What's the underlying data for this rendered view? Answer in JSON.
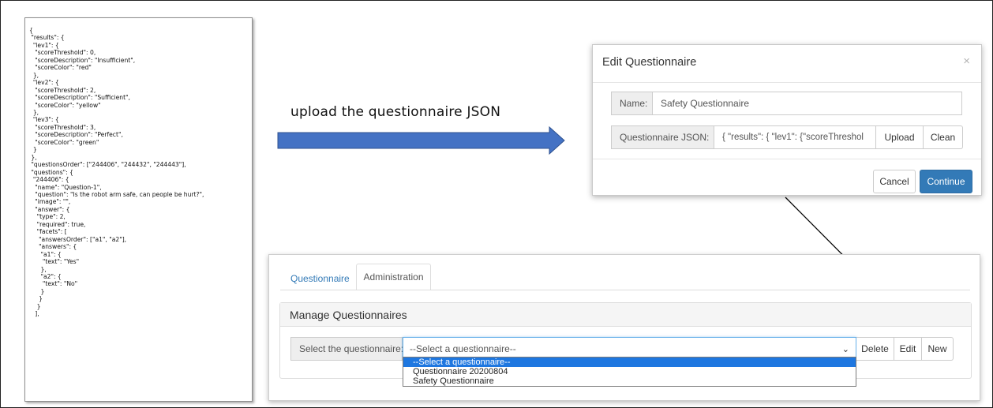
{
  "json_document": {
    "lines": [
      "{",
      " \"results\": {",
      "  \"lev1\": {",
      "   \"scoreThreshold\": 0,",
      "   \"scoreDescription\": \"Insufficient\",",
      "   \"scoreColor\": \"red\"",
      "  },",
      "  \"lev2\": {",
      "   \"scoreThreshold\": 2,",
      "   \"scoreDescription\": \"Sufficient\",",
      "   \"scoreColor\": \"yellow\"",
      "  },",
      "  \"lev3\": {",
      "   \"scoreThreshold\": 3,",
      "   \"scoreDescription\": \"Perfect\",",
      "   \"scoreColor\": \"green\"",
      "  }",
      " },",
      " \"questionsOrder\": [\"244406\", \"244432\", \"244443\"],",
      " \"questions\": {",
      "  \"244406\": {",
      "   \"name\": \"Question-1\",",
      "   \"question\": \"Is the robot arm safe, can people be hurt?\",",
      "   \"image\": \"\",",
      "   \"answer\": {",
      "    \"type\": 2,",
      "    \"required\": true,",
      "    \"facets\": [",
      "     \"answersOrder\": [\"a1\", \"a2\"],",
      "     \"answers\": {",
      "      \"a1\": {",
      "       \"text\": \"Yes\"",
      "      },",
      "      \"a2\": {",
      "       \"text\": \"No\"",
      "      }",
      "     }",
      "    }",
      "   ],"
    ]
  },
  "annotation": {
    "caption": "upload the questionnaire JSON",
    "arrow_color": "#4472c4",
    "arrow_border": "#2f528f"
  },
  "edit_modal": {
    "title": "Edit Questionnaire",
    "close": "×",
    "name_label": "Name:",
    "name_value": "Safety Questionnaire",
    "json_label": "Questionnaire JSON:",
    "json_value": "{ \"results\": {  \"lev1\": {\"scoreThreshol",
    "upload_button": "Upload",
    "clean_button": "Clean",
    "cancel_button": "Cancel",
    "continue_button": "Continue"
  },
  "admin": {
    "tabs": [
      {
        "label": "Questionnaire",
        "active": false
      },
      {
        "label": "Administration",
        "active": true
      }
    ],
    "panel_title": "Manage Questionnaires",
    "select_label": "Select the questionnaire:",
    "select_value": "--Select a questionnaire--",
    "delete_button": "Delete",
    "edit_button": "Edit",
    "new_button": "New",
    "dropdown_options": [
      {
        "label": "--Select a questionnaire--",
        "selected": true
      },
      {
        "label": "Questionnaire 20200804",
        "selected": false
      },
      {
        "label": "Safety Questionnaire",
        "selected": false
      }
    ]
  },
  "colors": {
    "primary": "#337ab7",
    "link": "#337ab7",
    "dropdown_highlight": "#1e77e0"
  }
}
